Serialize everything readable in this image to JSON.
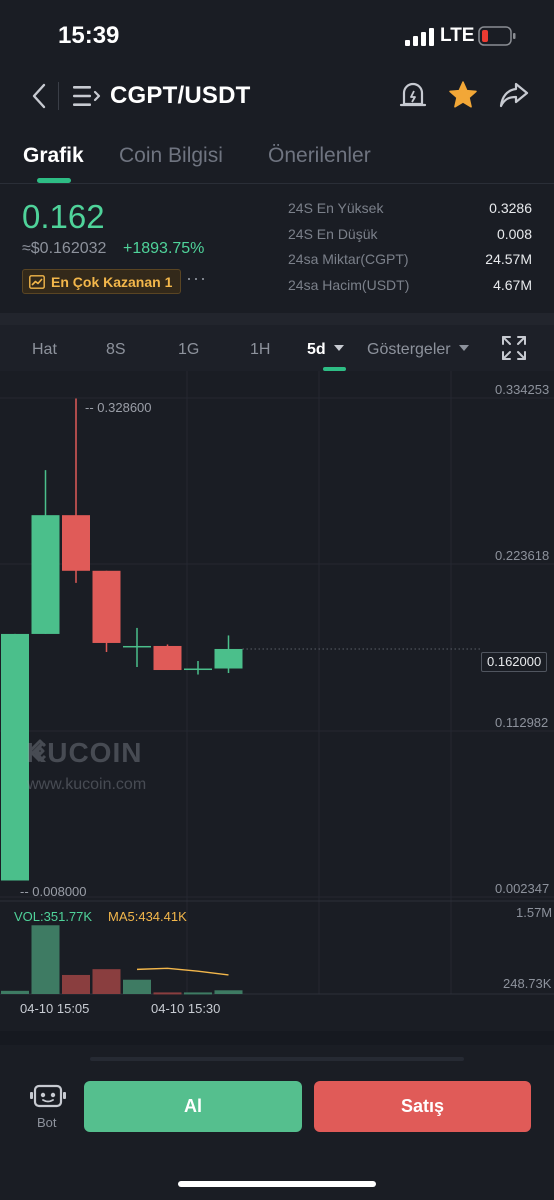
{
  "status_bar": {
    "time": "15:39",
    "network": "LTE"
  },
  "header": {
    "pair": "CGPT/USDT",
    "icons": [
      "back-chevron-icon",
      "menu-list-icon",
      "price-alert-icon",
      "star-icon",
      "share-icon"
    ]
  },
  "tabs": [
    {
      "label": "Grafik",
      "active": true
    },
    {
      "label": "Coin Bilgisi",
      "active": false
    },
    {
      "label": "Önerilenler",
      "active": false
    }
  ],
  "price": {
    "last": "0.162",
    "fiat": "≈$0.162032",
    "change": "+1893.75%",
    "badge": "En Çok Kazanan 1",
    "more": "···"
  },
  "stats": [
    {
      "label": "24S En Yüksek",
      "value": "0.3286"
    },
    {
      "label": "24S En Düşük",
      "value": "0.008"
    },
    {
      "label": "24sa Miktar(CGPT)",
      "value": "24.57M"
    },
    {
      "label": "24sa Hacim(USDT)",
      "value": "4.67M"
    }
  ],
  "intervals": {
    "items": [
      "Hat",
      "8S",
      "1G",
      "1H",
      "5d"
    ],
    "active": "5d",
    "indicators": "Göstergeler",
    "fullscreen_icon": "expand-icon"
  },
  "chart": {
    "price_axis": [
      "0.334253",
      "0.223618",
      "0.112982",
      "0.002347"
    ],
    "current_price": "0.162000",
    "high_annotation": "0.328600",
    "low_annotation": "0.008000",
    "watermark_brand": "KUCOIN",
    "watermark_url": "www.kucoin.com",
    "vol_label": "VOL:351.77K",
    "ma_label": "MA5:434.41K",
    "vol_axis": [
      "1.57M",
      "248.73K"
    ],
    "time_labels": [
      "04-10 15:05",
      "04-10 15:30"
    ],
    "colors": {
      "up": "#4bbf8b",
      "down": "#e05b58",
      "ma5": "#f3b74b"
    }
  },
  "chart_data": {
    "type": "candlestick",
    "x": [
      "04-10 15:00",
      "04-10 15:05",
      "04-10 15:10",
      "04-10 15:15",
      "04-10 15:20",
      "04-10 15:25",
      "04-10 15:30",
      "04-10 15:35",
      "04-10 15:40"
    ],
    "ohlc": [
      {
        "o": 0.008,
        "h": 0.172,
        "l": 0.008,
        "c": 0.172
      },
      {
        "o": 0.172,
        "h": 0.281,
        "l": 0.172,
        "c": 0.251
      },
      {
        "o": 0.251,
        "h": 0.3286,
        "l": 0.206,
        "c": 0.214
      },
      {
        "o": 0.214,
        "h": 0.2,
        "l": 0.16,
        "c": 0.166
      },
      {
        "o": 0.164,
        "h": 0.176,
        "l": 0.15,
        "c": 0.164
      },
      {
        "o": 0.164,
        "h": 0.165,
        "l": 0.148,
        "c": 0.148
      },
      {
        "o": 0.148,
        "h": 0.154,
        "l": 0.145,
        "c": 0.149
      },
      {
        "o": 0.149,
        "h": 0.171,
        "l": 0.146,
        "c": 0.162
      }
    ],
    "volume": [
      {
        "v": 60000,
        "dir": "up"
      },
      {
        "v": 1300000,
        "dir": "up"
      },
      {
        "v": 360000,
        "dir": "down"
      },
      {
        "v": 470000,
        "dir": "down"
      },
      {
        "v": 270000,
        "dir": "up"
      },
      {
        "v": 30000,
        "dir": "down"
      },
      {
        "v": 30000,
        "dir": "up"
      },
      {
        "v": 70000,
        "dir": "up"
      }
    ],
    "ma5": [
      null,
      null,
      null,
      null,
      466000,
      486000,
      432000,
      360000
    ],
    "ylim": [
      0.002347,
      0.334253
    ],
    "vol_ylim": [
      0,
      1570000
    ]
  },
  "bottom": {
    "bot_label": "Bot",
    "buy_label": "Al",
    "sell_label": "Satış"
  }
}
